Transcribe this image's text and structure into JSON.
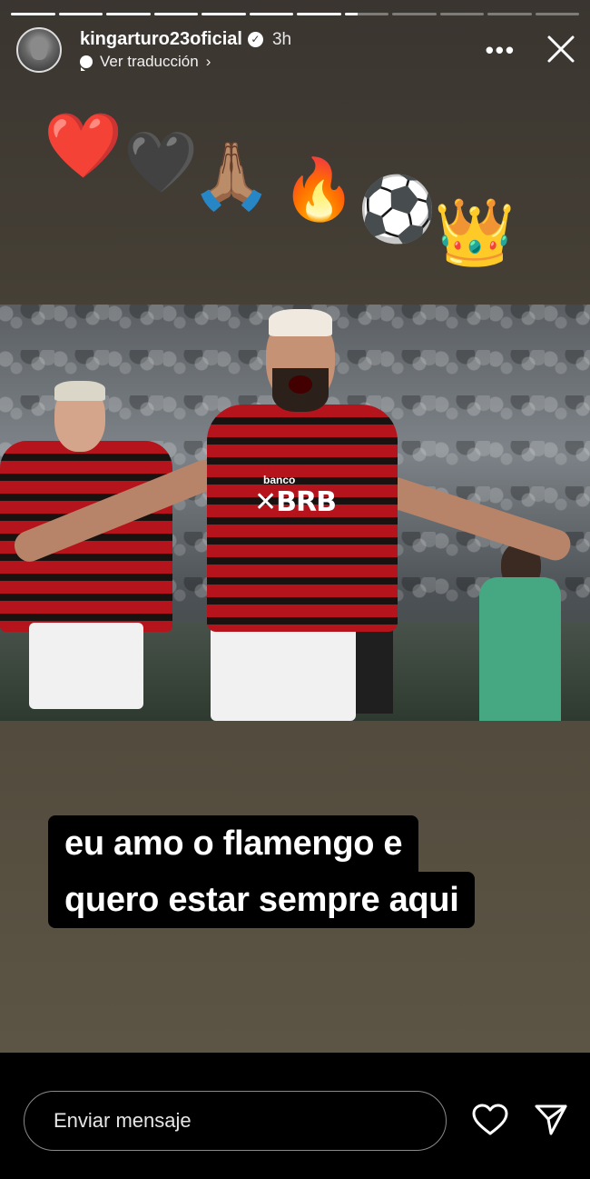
{
  "story": {
    "progress": {
      "total_segments": 12,
      "completed_segments": 7,
      "current_segment_fraction": 0.3
    },
    "header": {
      "username": "kingarturo23oficial",
      "time_ago": "3h",
      "translate_label": "Ver traducción",
      "more_icon": "more-horizontal-icon",
      "close_icon": "close-icon"
    },
    "stickers": [
      "❤️",
      "🖤",
      "🙏🏽",
      "🔥",
      "⚽",
      "👑"
    ],
    "caption": {
      "line1": "eu amo o flamengo e",
      "line2": "quero estar sempre aqui"
    },
    "photo": {
      "sponsor_top": "banco",
      "sponsor_main": "BRB"
    }
  },
  "footer": {
    "message_placeholder": "Enviar mensaje",
    "like_icon": "heart-icon",
    "share_icon": "send-icon"
  },
  "colors": {
    "background": "#000000",
    "story_bg": "#4a4438",
    "caption_bg": "#000000",
    "jersey_red": "#b5141c"
  }
}
